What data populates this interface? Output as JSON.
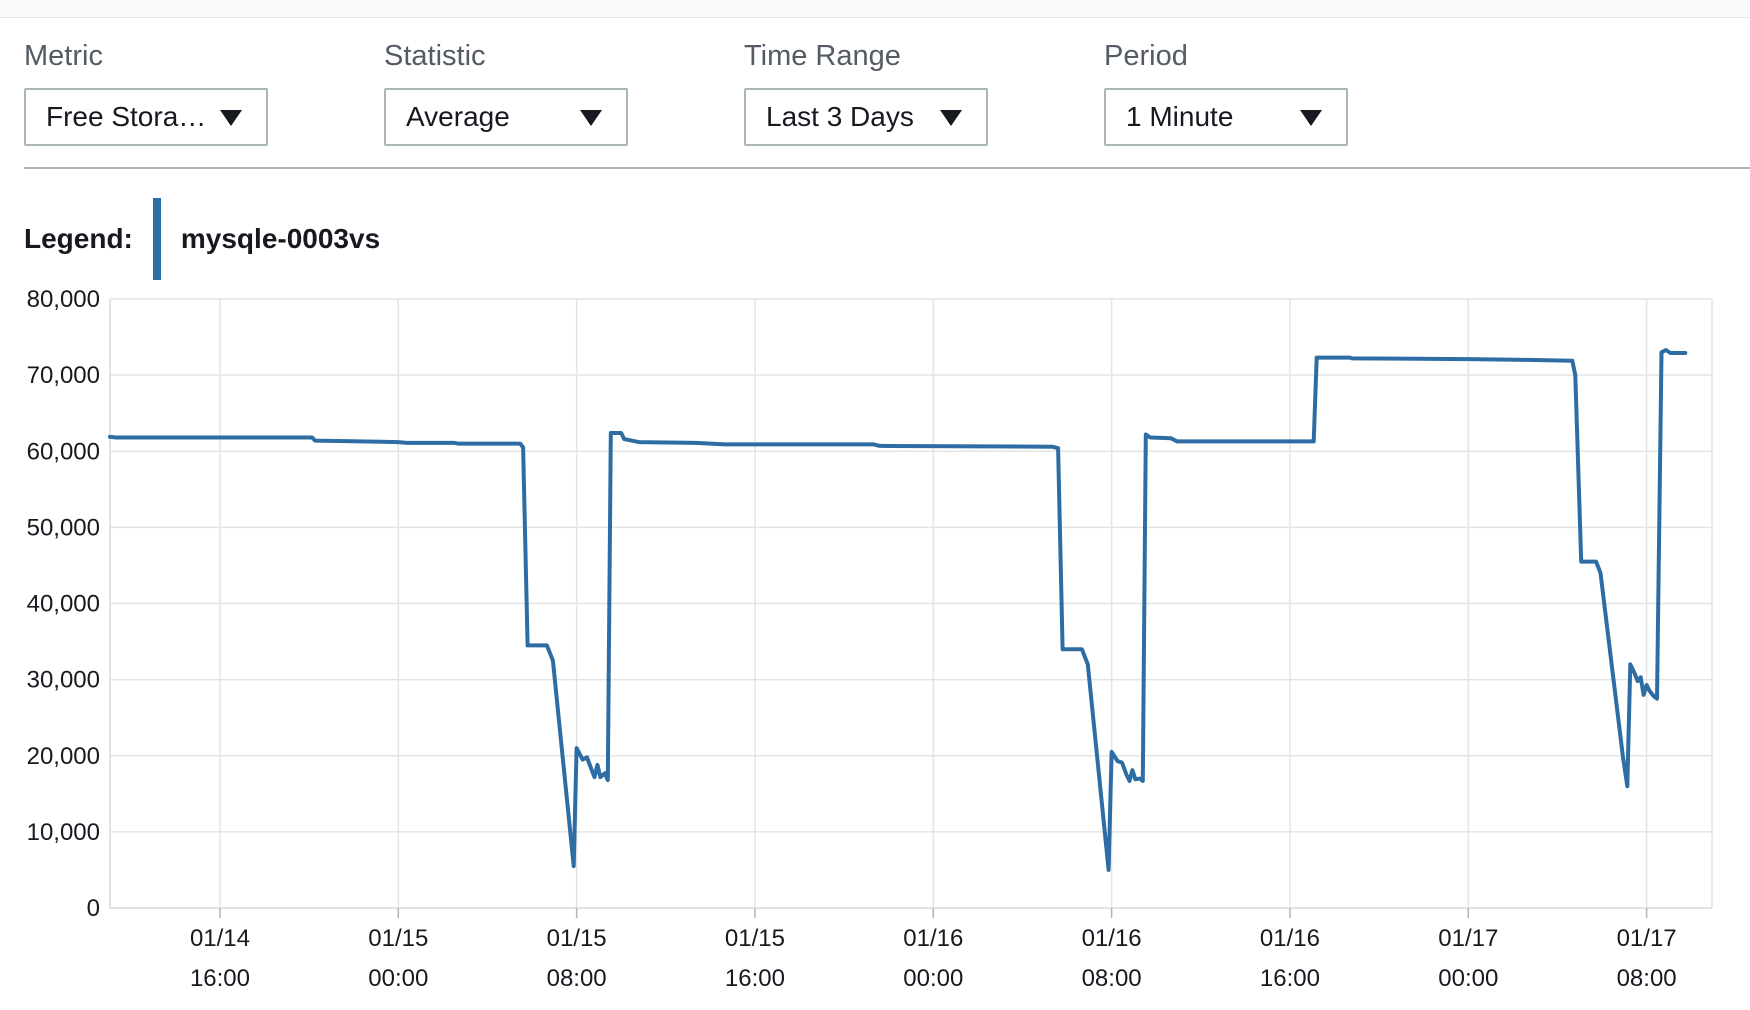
{
  "controls": [
    {
      "label": "Metric",
      "value": "Free Stora…"
    },
    {
      "label": "Statistic",
      "value": "Average"
    },
    {
      "label": "Time Range",
      "value": "Last 3 Days"
    },
    {
      "label": "Period",
      "value": "1 Minute"
    }
  ],
  "legend": {
    "title": "Legend:",
    "series_name": "mysqle-0003vs",
    "color": "#2e6da4"
  },
  "chart_data": {
    "type": "line",
    "xlabel": "",
    "ylabel": "",
    "ylim": [
      0,
      80000
    ],
    "xlim_hours": [
      -9.7,
      44.2
    ],
    "grid": true,
    "legend_position": "top-left",
    "y_ticks": [
      0,
      10000,
      20000,
      30000,
      40000,
      50000,
      60000,
      70000,
      80000
    ],
    "y_tick_labels": [
      "0",
      "10,000",
      "20,000",
      "30,000",
      "40,000",
      "50,000",
      "60,000",
      "70,000",
      "80,000"
    ],
    "x_ticks": [
      {
        "hour": -6,
        "date": "01/14",
        "time": "16:00"
      },
      {
        "hour": 0,
        "date": "01/15",
        "time": "00:00"
      },
      {
        "hour": 6,
        "date": "01/15",
        "time": "08:00"
      },
      {
        "hour": 12,
        "date": "01/15",
        "time": "16:00"
      },
      {
        "hour": 18,
        "date": "01/16",
        "time": "00:00"
      },
      {
        "hour": 24,
        "date": "01/16",
        "time": "08:00"
      },
      {
        "hour": 30,
        "date": "01/16",
        "time": "16:00"
      },
      {
        "hour": 36,
        "date": "01/17",
        "time": "00:00"
      },
      {
        "hour": 42,
        "date": "01/17",
        "time": "08:00"
      }
    ],
    "series": [
      {
        "name": "mysqle-0003vs",
        "color": "#2e6da4",
        "points": [
          [
            -9.7,
            61900
          ],
          [
            -9.5,
            61800
          ],
          [
            -2.9,
            61800
          ],
          [
            -2.8,
            61400
          ],
          [
            0.0,
            61200
          ],
          [
            0.3,
            61100
          ],
          [
            1.9,
            61100
          ],
          [
            2.0,
            61000
          ],
          [
            4.1,
            61000
          ],
          [
            4.2,
            60500
          ],
          [
            4.35,
            34500
          ],
          [
            5.0,
            34500
          ],
          [
            5.2,
            32500
          ],
          [
            5.9,
            5500
          ],
          [
            6.0,
            21000
          ],
          [
            6.2,
            19500
          ],
          [
            6.35,
            19800
          ],
          [
            6.5,
            18200
          ],
          [
            6.6,
            17200
          ],
          [
            6.7,
            18800
          ],
          [
            6.8,
            17200
          ],
          [
            6.95,
            17700
          ],
          [
            7.05,
            16800
          ],
          [
            7.15,
            62400
          ],
          [
            7.5,
            62400
          ],
          [
            7.6,
            61600
          ],
          [
            8.1,
            61200
          ],
          [
            10.0,
            61100
          ],
          [
            11.0,
            60900
          ],
          [
            16.0,
            60900
          ],
          [
            16.2,
            60700
          ],
          [
            22.0,
            60600
          ],
          [
            22.2,
            60400
          ],
          [
            22.35,
            34000
          ],
          [
            23.0,
            34000
          ],
          [
            23.2,
            32000
          ],
          [
            23.9,
            5000
          ],
          [
            24.0,
            20500
          ],
          [
            24.2,
            19300
          ],
          [
            24.35,
            19100
          ],
          [
            24.5,
            17500
          ],
          [
            24.6,
            16700
          ],
          [
            24.7,
            18100
          ],
          [
            24.8,
            16900
          ],
          [
            24.95,
            17000
          ],
          [
            25.05,
            16700
          ],
          [
            25.15,
            62200
          ],
          [
            25.3,
            61800
          ],
          [
            26.0,
            61700
          ],
          [
            26.2,
            61300
          ],
          [
            30.0,
            61300
          ],
          [
            30.8,
            61300
          ],
          [
            30.9,
            72300
          ],
          [
            32.0,
            72300
          ],
          [
            32.1,
            72200
          ],
          [
            36.0,
            72100
          ],
          [
            38.0,
            72000
          ],
          [
            39.5,
            71900
          ],
          [
            39.6,
            70000
          ],
          [
            39.8,
            45500
          ],
          [
            40.3,
            45500
          ],
          [
            40.45,
            44000
          ],
          [
            41.2,
            20000
          ],
          [
            41.35,
            16000
          ],
          [
            41.45,
            32000
          ],
          [
            41.6,
            30800
          ],
          [
            41.7,
            29800
          ],
          [
            41.8,
            30300
          ],
          [
            41.9,
            28000
          ],
          [
            42.0,
            29300
          ],
          [
            42.1,
            28500
          ],
          [
            42.25,
            27800
          ],
          [
            42.35,
            27500
          ],
          [
            42.5,
            73000
          ],
          [
            42.65,
            73300
          ],
          [
            42.8,
            72900
          ],
          [
            43.3,
            72900
          ]
        ]
      }
    ]
  }
}
